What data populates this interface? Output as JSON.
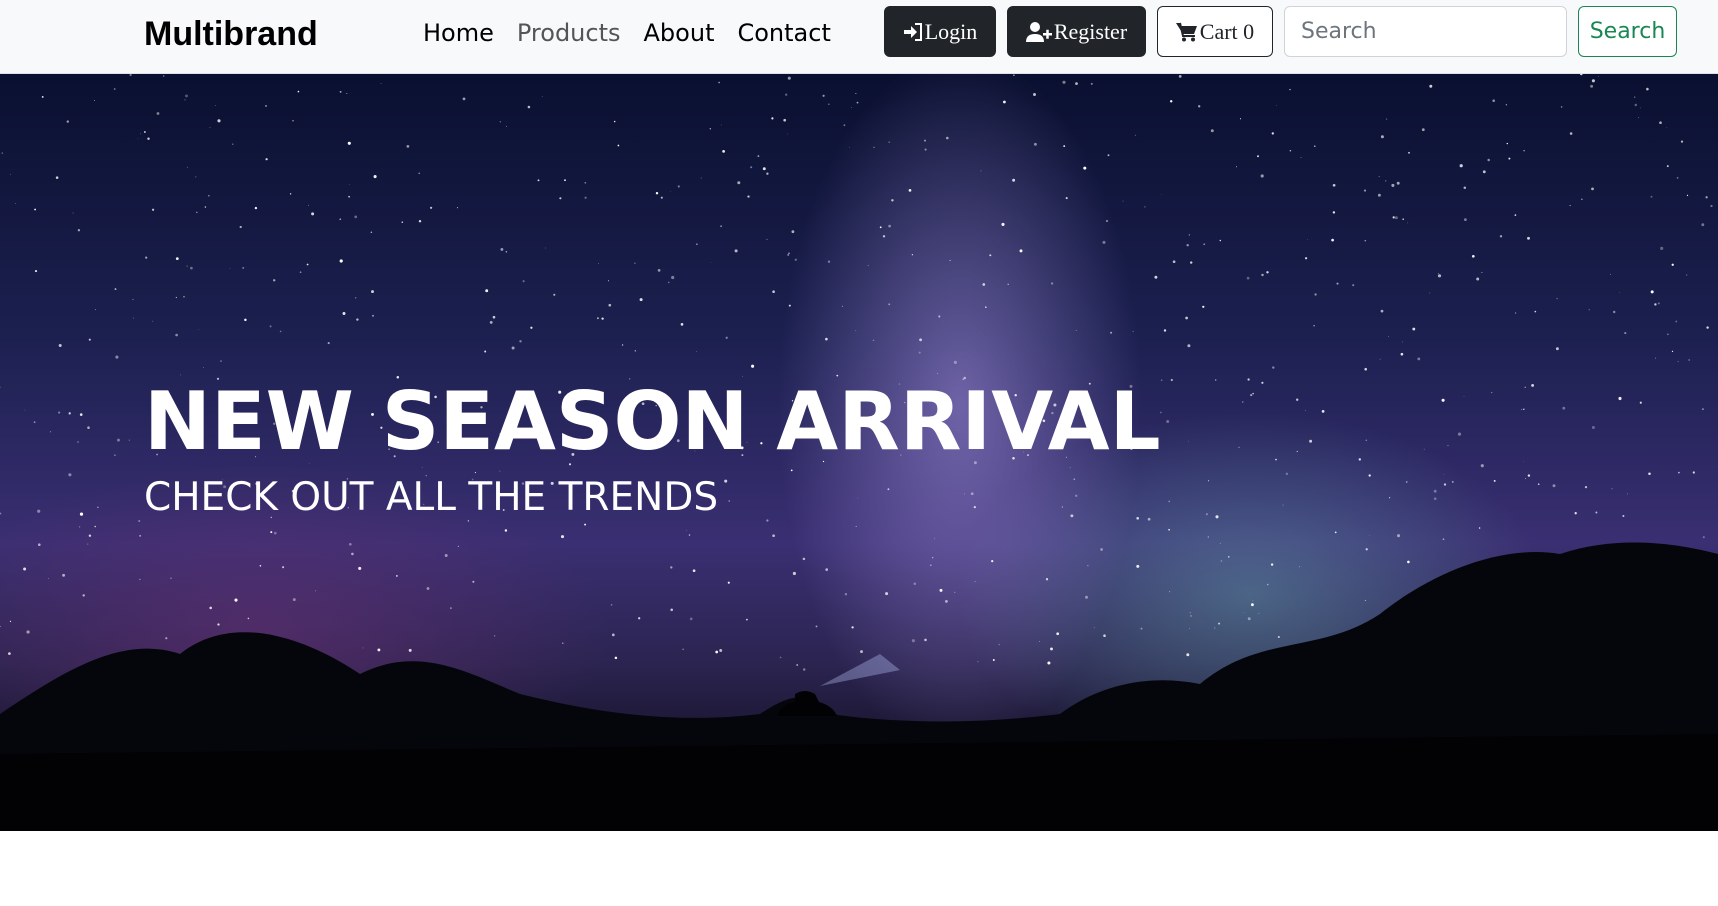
{
  "navbar": {
    "brand": "Multibrand",
    "links": [
      {
        "label": "Home",
        "active": false
      },
      {
        "label": "Products",
        "active": true
      },
      {
        "label": "About",
        "active": false
      },
      {
        "label": "Contact",
        "active": false
      }
    ],
    "login_label": "Login",
    "register_label": "Register",
    "cart_label": "Cart 0",
    "search_placeholder": "Search",
    "search_value": "",
    "search_button_label": "Search",
    "icons": {
      "login": "sign-in-icon",
      "register": "user-plus-icon",
      "cart": "shopping-cart-icon"
    }
  },
  "hero": {
    "title": "NEW SEASON ARRIVAL",
    "subtitle": "CHECK OUT ALL THE TRENDS"
  },
  "colors": {
    "navbar_bg": "#f8f9fa",
    "dark": "#212529",
    "success": "#198754",
    "muted_link": "#555555"
  }
}
